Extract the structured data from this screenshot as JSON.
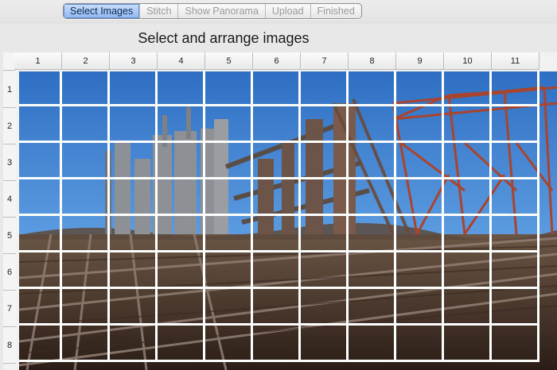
{
  "toolbar": {
    "tabs": [
      {
        "label": "Select Images",
        "active": true
      },
      {
        "label": "Stitch",
        "active": false
      },
      {
        "label": "Show Panorama",
        "active": false
      },
      {
        "label": "Upload",
        "active": false
      },
      {
        "label": "Finished",
        "active": false
      }
    ]
  },
  "main": {
    "title": "Select and arrange images"
  },
  "grid": {
    "columns": [
      "1",
      "2",
      "3",
      "4",
      "5",
      "6",
      "7",
      "8",
      "9",
      "10",
      "11"
    ],
    "rows": [
      "1",
      "2",
      "3",
      "4",
      "5",
      "6",
      "7",
      "8"
    ]
  },
  "colors": {
    "sky": "#3d7fcf",
    "rail_ground": "#4d3528",
    "steel": "#8c8f93",
    "rust": "#8a3a22",
    "tile_gap": "#ffffff",
    "active_tab": "#8fb7ef"
  }
}
